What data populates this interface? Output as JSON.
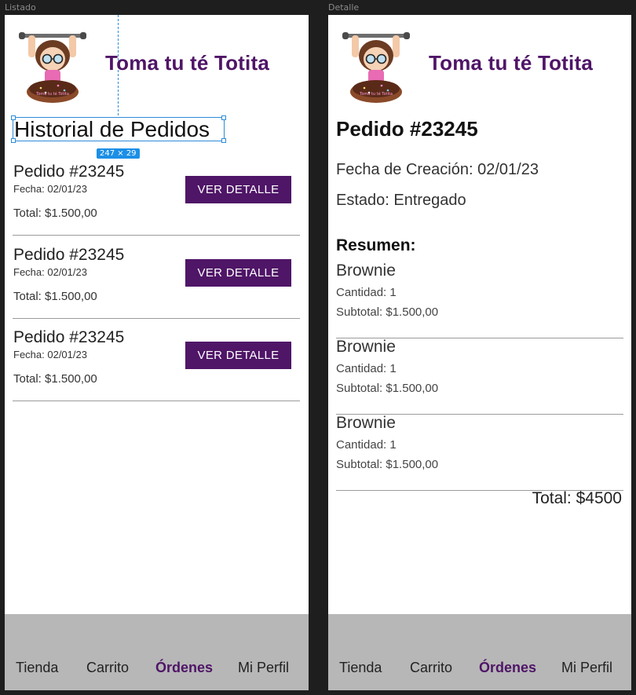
{
  "frames": {
    "list_label": "Listado",
    "detail_label": "Detalle"
  },
  "brand": {
    "name": "Toma tu té Totita",
    "mascot_caption": "Toma tu té Totita",
    "color": "#4f1567"
  },
  "list": {
    "title": "Historial de Pedidos",
    "selection_size": "247 × 29",
    "orders": [
      {
        "title": "Pedido #23245",
        "date": "Fecha: 02/01/23",
        "total": "Total: $1.500,00",
        "button": "VER DETALLE"
      },
      {
        "title": "Pedido #23245",
        "date": "Fecha: 02/01/23",
        "total": "Total: $1.500,00",
        "button": "VER DETALLE"
      },
      {
        "title": "Pedido #23245",
        "date": "Fecha: 02/01/23",
        "total": "Total: $1.500,00",
        "button": "VER DETALLE"
      }
    ]
  },
  "detail": {
    "title": "Pedido #23245",
    "created": "Fecha de Creación: 02/01/23",
    "status": "Estado: Entregado",
    "summary_title": "Resumen:",
    "items": [
      {
        "name": "Brownie",
        "qty": "Cantidad: 1",
        "subtotal": "Subtotal: $1.500,00"
      },
      {
        "name": "Brownie",
        "qty": "Cantidad: 1",
        "subtotal": "Subtotal: $1.500,00"
      },
      {
        "name": "Brownie",
        "qty": "Cantidad: 1",
        "subtotal": "Subtotal: $1.500,00"
      }
    ],
    "total": "Total: $4500"
  },
  "nav": {
    "items": [
      "Tienda",
      "Carrito",
      "Órdenes",
      "Mi Perfil"
    ],
    "active": "Órdenes"
  }
}
